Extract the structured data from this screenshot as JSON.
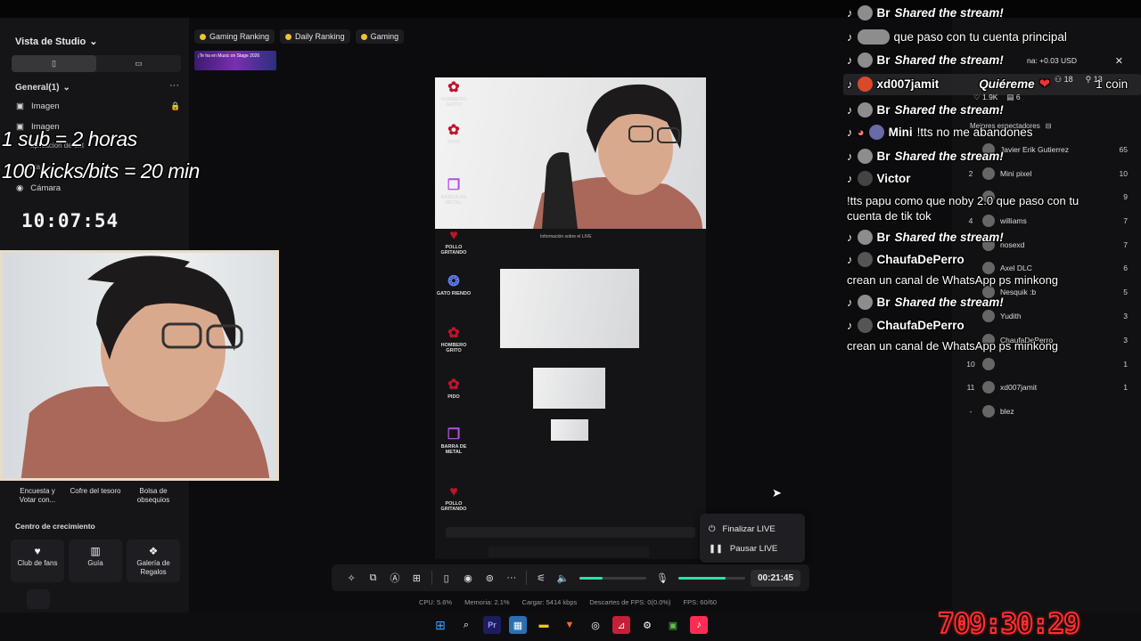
{
  "left_panel": {
    "studio_view": "Vista de Studio",
    "general": "General(1)",
    "sources": [
      "Imagen",
      "Imagen",
      "Cámara"
    ],
    "partial_sources": [
      "aplicación de ent",
      "nta"
    ],
    "overlay_line1": "1 sub = 2 horas",
    "overlay_line2": "100 kicks/bits = 20 min",
    "timer": "10:07:54",
    "tools": [
      "Encuesta y Votar con...",
      "Cofre del tesoro",
      "Bolsa de obsequios"
    ],
    "growth_title": "Centro de crecimiento",
    "growth_tools": [
      "Club de fans",
      "Guía",
      "Galería de Regalos"
    ]
  },
  "tabs": [
    "Gaming Ranking",
    "Daily Ranking",
    "Gaming"
  ],
  "banner_text": "¡Te ha en Music on Stage 2026",
  "nested_screen": {
    "alerts": [
      "HOMBERO GRITO",
      "PIDO",
      "BARRA DE METAL",
      "POLLO GRITANDO",
      "GATO RIENDO",
      "HOMBERO GRITO",
      "PIDO",
      "BARRA DE METAL",
      "POLLO GRITANDO"
    ],
    "info_line": "Información sobre el LIVE"
  },
  "popup": {
    "end_live": "Finalizar LIVE",
    "pause_live": "Pausar LIVE"
  },
  "control_bar": {
    "duration": "00:21:45",
    "speaker_level": 0.35,
    "mic_level": 0.7
  },
  "stats": {
    "cpu": "CPU: 5.6%",
    "memory": "Memoria: 2.1%",
    "upload": "Cargar: 5414 kbps",
    "dropped": "Descartes de FPS: 0(0.0%)",
    "fps": "FPS: 60/60"
  },
  "chat": {
    "shared": "Shared the stream!",
    "br": "Br",
    "line2": "que paso con tu cuenta principal",
    "header_partial": "na: +0.03 USD",
    "featured_name": "xd007jamit",
    "featured_msg": "Quiéreme",
    "featured_coin": "1 coin",
    "stat_likes": "1.9K",
    "stat_six": "6",
    "stat_18": "18",
    "stat_13": "13",
    "mini_name": "Mini",
    "mini_msg": "!tts no me abandones",
    "victor_name": "Victor",
    "victor_msg": "!tts papu como que noby 2.0 que paso con tu cuenta de tik tok",
    "chaufa_name": "ChaufaDePerro",
    "chaufa_msg": "crean un canal de WhatsApp ps minkong"
  },
  "ranking": {
    "best_viewers": "Mejores espectadores",
    "rows": [
      {
        "n": "",
        "name": "Javier Erik Gutierrez",
        "score": "65"
      },
      {
        "n": "2",
        "name": "Mini pixel",
        "score": "10"
      },
      {
        "n": "",
        "name": "",
        "score": "9"
      },
      {
        "n": "4",
        "name": "williams",
        "score": "7"
      },
      {
        "n": "",
        "name": "nosexd",
        "score": "7"
      },
      {
        "n": "",
        "name": "Axel DLC",
        "score": "6"
      },
      {
        "n": "",
        "name": "Nesquik :b",
        "score": "5"
      },
      {
        "n": "",
        "name": "Yudith",
        "score": "3"
      },
      {
        "n": "",
        "name": "ChaufaDePerro",
        "score": "3"
      },
      {
        "n": "10",
        "name": "",
        "score": "1"
      },
      {
        "n": "11",
        "name": "xd007jamit",
        "score": "1"
      },
      {
        "n": "-",
        "name": "blez",
        "score": ""
      }
    ]
  },
  "countdown": "709:30:29",
  "colors": {
    "accent": "#2fe0a5",
    "countdown": "#ff3030",
    "tiktok_red": "#fe2c55"
  }
}
